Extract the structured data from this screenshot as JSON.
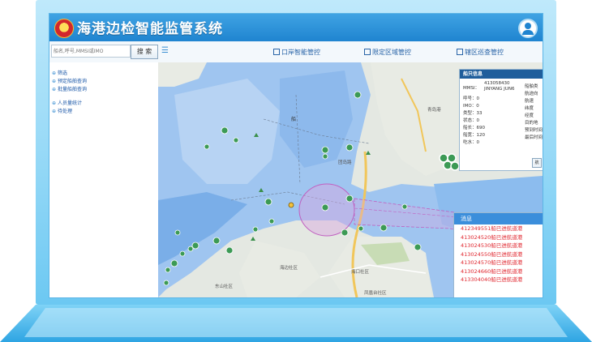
{
  "app": {
    "title": "海港边检智能监管系统"
  },
  "toolbar": {
    "search_placeholder": "船名,呼号,MMSI或IMO",
    "search_button": "搜 索",
    "tabs": [
      {
        "label": "口岸智能管控"
      },
      {
        "label": "限定区域管控"
      },
      {
        "label": "辖区巡查管控"
      }
    ]
  },
  "sidebar": {
    "items": [
      {
        "label": "筛选"
      },
      {
        "label": "预定船舶查询"
      },
      {
        "label": "批量船舶查询"
      },
      {
        "label": "人员量统计"
      },
      {
        "label": "待处理"
      }
    ]
  },
  "ship_info": {
    "title": "船只信息",
    "mmsi_label": "MMSI：",
    "mmsi_value": "413058430",
    "name_value": "JINYANG JUN6",
    "callsign": "呼号：0",
    "imo": "IMO：0",
    "type": "类型：33",
    "status": "状态：0",
    "length": "船长：690",
    "width": "船宽：120",
    "draft": "吃水：0",
    "right_labels": [
      "船舶类",
      "航迹向",
      "航速",
      "纬度",
      "经度",
      "目的地",
      "预到时间",
      "最后时间"
    ],
    "button": "航"
  },
  "messages": {
    "title": "消息",
    "items": [
      "412349551船已进航道港",
      "413024520船已进航道港",
      "413024530船已进航道港",
      "413024550船已进航道港",
      "413024570船已进航道港",
      "413024660船已进航道港",
      "413304040船已进航道港"
    ]
  },
  "map_labels": {
    "district_1": "海口社区",
    "district_2": "海边社区",
    "district_3": "东山社区",
    "district_4": "凤凰台社区",
    "district_5": "团岛路",
    "district_6": "青岛港"
  },
  "colors": {
    "header": "#1f84d0",
    "message_text": "#e0262e",
    "zone": "#c060c0"
  }
}
